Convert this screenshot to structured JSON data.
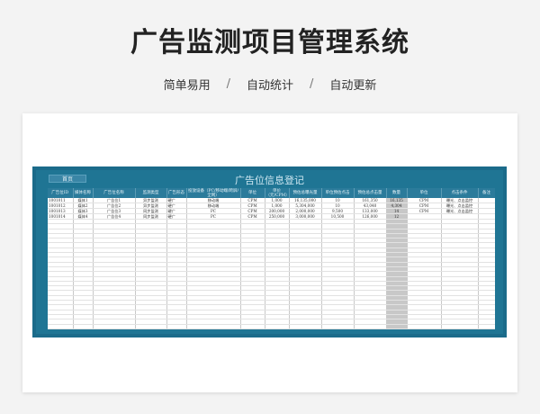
{
  "page": {
    "title": "广告监测项目管理系统",
    "features": [
      "简单易用",
      "自动统计",
      "自动更新"
    ],
    "separator": "/"
  },
  "sheet": {
    "home_label": "首页",
    "title": "广告位信息登记",
    "colors": {
      "frame": "#1b6b8a",
      "header": "#2b7b9b",
      "highlight_column": "#c8c8c8"
    },
    "columns": [
      "广告位ID",
      "媒体名称",
      "广告位名称",
      "监测类型",
      "广告形态",
      "投放设备（PC/移动端/跨屏/全网）",
      "单位",
      "单价（元/CPM）",
      "预估总曝光量",
      "单位预估点击",
      "预估总点击量",
      "数量",
      "单位",
      "点击条件",
      "备注"
    ],
    "rows": [
      [
        "1001011",
        "媒体1",
        "广告位1",
        "异步监测",
        "硬广",
        "移动端",
        "CPM",
        "1,000",
        "16,135,000",
        "10",
        "161,350",
        "16,135",
        "CPM",
        "曝光、点击监控",
        ""
      ],
      [
        "1001012",
        "媒体2",
        "广告位2",
        "异步监测",
        "硬广",
        "移动端",
        "CPM",
        "1,000",
        "5,304,000",
        "10",
        "43,040",
        "4,304",
        "CPM",
        "曝光、点击监控",
        ""
      ],
      [
        "1001013",
        "媒体3",
        "广告位3",
        "同步监测",
        "硬广",
        "PC",
        "CPM",
        "200,000",
        "2,000,000",
        "9,500",
        "133,000",
        "14",
        "CPM",
        "曝光、点击监控",
        ""
      ],
      [
        "1001014",
        "媒体4",
        "广告位4",
        "同步监测",
        "硬广",
        "PC",
        "CPM",
        "250,000",
        "3,000,000",
        "10,500",
        "126,000",
        "12",
        "",
        "",
        ""
      ]
    ]
  }
}
